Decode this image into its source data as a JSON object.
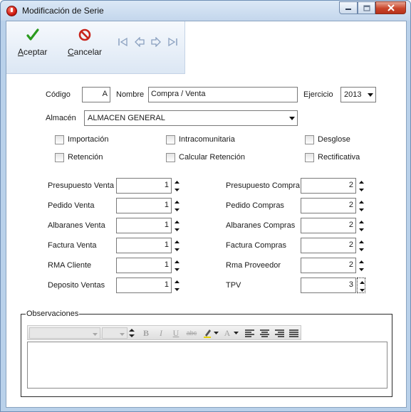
{
  "window": {
    "title": "Modificación de Serie"
  },
  "toolbar": {
    "accept_label_first": "A",
    "accept_label_rest": "ceptar",
    "cancel_label_first": "C",
    "cancel_label_rest": "ancelar",
    "icons": [
      "check-icon",
      "cancel-icon",
      "first-record-icon",
      "prev-record-icon",
      "next-record-icon",
      "last-record-icon"
    ]
  },
  "header": {
    "codigo_label": "Código",
    "codigo_value": "A",
    "nombre_label": "Nombre",
    "nombre_value": "Compra / Venta",
    "ejercicio_label": "Ejercicio",
    "ejercicio_value": "2013",
    "almacen_label": "Almacén",
    "almacen_value": "ALMACEN GENERAL"
  },
  "checkboxes": {
    "importacion": "Importación",
    "intracomunitaria": "Intracomunitaria",
    "desglose": "Desglose",
    "retencion": "Retención",
    "calcular_retencion": "Calcular Retención",
    "rectificativa": "Rectificativa"
  },
  "counters_left": [
    {
      "label": "Presupuesto Venta",
      "value": "1"
    },
    {
      "label": "Pedido Venta",
      "value": "1"
    },
    {
      "label": "Albaranes Venta",
      "value": "1"
    },
    {
      "label": "Factura Venta",
      "value": "1"
    },
    {
      "label": "RMA Cliente",
      "value": "1"
    },
    {
      "label": "Deposito Ventas",
      "value": "1"
    }
  ],
  "counters_right": [
    {
      "label": "Presupuesto Compra",
      "value": "2"
    },
    {
      "label": "Pedido Compras",
      "value": "2"
    },
    {
      "label": "Albaranes Compras",
      "value": "2"
    },
    {
      "label": "Factura Compras",
      "value": "2"
    },
    {
      "label": "Rma Proveedor",
      "value": "2"
    },
    {
      "label": "TPV",
      "value": "3"
    }
  ],
  "observaciones": {
    "title": "Observaciones",
    "editor_buttons": {
      "bold": "B",
      "italic": "I",
      "underline": "U",
      "strike": "abc",
      "font_color": "A"
    }
  },
  "colors": {
    "window_frame": "#b9d1ea",
    "accept_green": "#2a9a1e",
    "cancel_red": "#c8241b"
  }
}
